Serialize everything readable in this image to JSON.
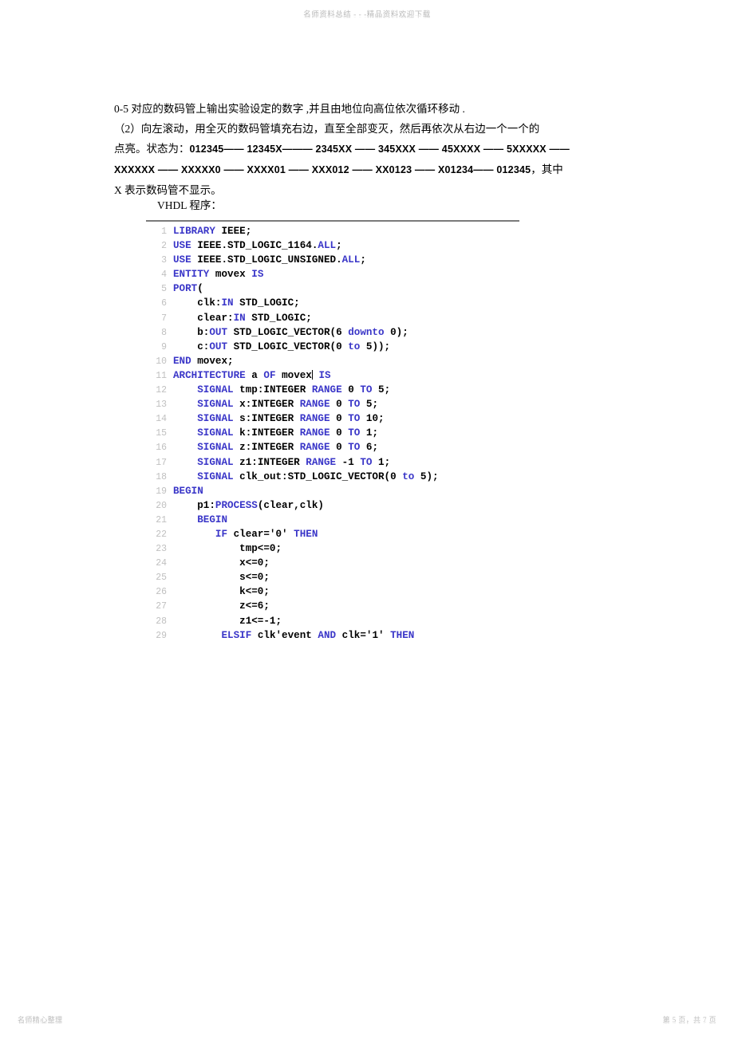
{
  "watermarks": {
    "header": "名师资料总结 - - -精品资料欢迎下载",
    "footer_left": "名师精心整理",
    "footer_right": "第 5 页，共 7 页"
  },
  "prose": {
    "line1_prefix": "0-5",
    "line1": "0-5 对应的数码管上输出实验设定的数字       ,并且由地位向高位依次循环移动        .",
    "line2": "（2）向左滚动，用全灭的数码管填充右边，直至全部变灭，然后再依次从右边一个一个的",
    "line3_prefix": "点亮。状态为：",
    "line3_states": "012345—— 12345X——— 2345XX —— 345XXX —— 45XXXX —— 5XXXXX ——",
    "line4_states": "XXXXXX —— XXXXX0 —— XXXX01 —— XXX012 —— XX0123 —— X01234—— 012345",
    "line4_suffix": "，其中",
    "line5": "X 表示数码管不显示。",
    "vhdl_label": "VHDL  程序："
  },
  "code": {
    "language": "VHDL",
    "keyword_color": "#3a36c8",
    "linenumber_color": "#c0c0c0",
    "lines": [
      {
        "n": "1",
        "tokens": [
          {
            "t": "kw",
            "s": "LIBRARY"
          },
          {
            "t": "id",
            "s": " IEEE;"
          }
        ]
      },
      {
        "n": "2",
        "tokens": [
          {
            "t": "kw",
            "s": "USE"
          },
          {
            "t": "id",
            "s": " IEEE.STD_LOGIC_1164."
          },
          {
            "t": "kw",
            "s": "ALL"
          },
          {
            "t": "id",
            "s": ";"
          }
        ]
      },
      {
        "n": "3",
        "tokens": [
          {
            "t": "kw",
            "s": "USE"
          },
          {
            "t": "id",
            "s": " IEEE.STD_LOGIC_UNSIGNED."
          },
          {
            "t": "kw",
            "s": "ALL"
          },
          {
            "t": "id",
            "s": ";"
          }
        ]
      },
      {
        "n": "4",
        "tokens": [
          {
            "t": "kw",
            "s": "ENTITY"
          },
          {
            "t": "id",
            "s": " movex "
          },
          {
            "t": "kw",
            "s": "IS"
          }
        ]
      },
      {
        "n": "5",
        "tokens": [
          {
            "t": "kw",
            "s": "PORT"
          },
          {
            "t": "id",
            "s": "("
          }
        ]
      },
      {
        "n": "6",
        "tokens": [
          {
            "t": "id",
            "s": "    clk:"
          },
          {
            "t": "kw",
            "s": "IN"
          },
          {
            "t": "id",
            "s": " STD_LOGIC;"
          }
        ]
      },
      {
        "n": "7",
        "tokens": [
          {
            "t": "id",
            "s": "    clear:"
          },
          {
            "t": "kw",
            "s": "IN"
          },
          {
            "t": "id",
            "s": " STD_LOGIC;"
          }
        ]
      },
      {
        "n": "8",
        "tokens": [
          {
            "t": "id",
            "s": "    b:"
          },
          {
            "t": "kw",
            "s": "OUT"
          },
          {
            "t": "id",
            "s": " STD_LOGIC_VECTOR(6 "
          },
          {
            "t": "kw",
            "s": "downto"
          },
          {
            "t": "id",
            "s": " 0);"
          }
        ]
      },
      {
        "n": "9",
        "tokens": [
          {
            "t": "id",
            "s": "    c:"
          },
          {
            "t": "kw",
            "s": "OUT"
          },
          {
            "t": "id",
            "s": " STD_LOGIC_VECTOR(0 "
          },
          {
            "t": "kw",
            "s": "to"
          },
          {
            "t": "id",
            "s": " 5));"
          }
        ]
      },
      {
        "n": "10",
        "tokens": [
          {
            "t": "kw",
            "s": "END"
          },
          {
            "t": "id",
            "s": " movex;"
          }
        ]
      },
      {
        "n": "11",
        "tokens": [
          {
            "t": "kw",
            "s": "ARCHITECTURE"
          },
          {
            "t": "id",
            "s": " a "
          },
          {
            "t": "kw",
            "s": "OF"
          },
          {
            "t": "id",
            "s": " movex"
          },
          {
            "t": "caret",
            "s": ""
          },
          {
            "t": "id",
            "s": " "
          },
          {
            "t": "kw",
            "s": "IS"
          }
        ]
      },
      {
        "n": "12",
        "tokens": [
          {
            "t": "id",
            "s": "    "
          },
          {
            "t": "kw",
            "s": "SIGNAL"
          },
          {
            "t": "id",
            "s": " tmp:INTEGER "
          },
          {
            "t": "kw",
            "s": "RANGE"
          },
          {
            "t": "id",
            "s": " 0 "
          },
          {
            "t": "kw",
            "s": "TO"
          },
          {
            "t": "id",
            "s": " 5;"
          }
        ]
      },
      {
        "n": "13",
        "tokens": [
          {
            "t": "id",
            "s": "    "
          },
          {
            "t": "kw",
            "s": "SIGNAL"
          },
          {
            "t": "id",
            "s": " x:INTEGER "
          },
          {
            "t": "kw",
            "s": "RANGE"
          },
          {
            "t": "id",
            "s": " 0 "
          },
          {
            "t": "kw",
            "s": "TO"
          },
          {
            "t": "id",
            "s": " 5;"
          }
        ]
      },
      {
        "n": "14",
        "tokens": [
          {
            "t": "id",
            "s": "    "
          },
          {
            "t": "kw",
            "s": "SIGNAL"
          },
          {
            "t": "id",
            "s": " s:INTEGER "
          },
          {
            "t": "kw",
            "s": "RANGE"
          },
          {
            "t": "id",
            "s": " 0 "
          },
          {
            "t": "kw",
            "s": "TO"
          },
          {
            "t": "id",
            "s": " 10;"
          }
        ]
      },
      {
        "n": "15",
        "tokens": [
          {
            "t": "id",
            "s": "    "
          },
          {
            "t": "kw",
            "s": "SIGNAL"
          },
          {
            "t": "id",
            "s": " k:INTEGER "
          },
          {
            "t": "kw",
            "s": "RANGE"
          },
          {
            "t": "id",
            "s": " 0 "
          },
          {
            "t": "kw",
            "s": "TO"
          },
          {
            "t": "id",
            "s": " 1;"
          }
        ]
      },
      {
        "n": "16",
        "tokens": [
          {
            "t": "id",
            "s": "    "
          },
          {
            "t": "kw",
            "s": "SIGNAL"
          },
          {
            "t": "id",
            "s": " z:INTEGER "
          },
          {
            "t": "kw",
            "s": "RANGE"
          },
          {
            "t": "id",
            "s": " 0 "
          },
          {
            "t": "kw",
            "s": "TO"
          },
          {
            "t": "id",
            "s": " 6;"
          }
        ]
      },
      {
        "n": "17",
        "tokens": [
          {
            "t": "id",
            "s": "    "
          },
          {
            "t": "kw",
            "s": "SIGNAL"
          },
          {
            "t": "id",
            "s": " z1:INTEGER "
          },
          {
            "t": "kw",
            "s": "RANGE"
          },
          {
            "t": "id",
            "s": " -1 "
          },
          {
            "t": "kw",
            "s": "TO"
          },
          {
            "t": "id",
            "s": " 1;"
          }
        ]
      },
      {
        "n": "18",
        "tokens": [
          {
            "t": "id",
            "s": "    "
          },
          {
            "t": "kw",
            "s": "SIGNAL"
          },
          {
            "t": "id",
            "s": " clk_out:STD_LOGIC_VECTOR(0 "
          },
          {
            "t": "kw",
            "s": "to"
          },
          {
            "t": "id",
            "s": " 5);"
          }
        ]
      },
      {
        "n": "19",
        "tokens": [
          {
            "t": "kw",
            "s": "BEGIN"
          }
        ]
      },
      {
        "n": "20",
        "tokens": [
          {
            "t": "id",
            "s": "    p1:"
          },
          {
            "t": "kw",
            "s": "PROCESS"
          },
          {
            "t": "id",
            "s": "(clear,clk)"
          }
        ]
      },
      {
        "n": "21",
        "tokens": [
          {
            "t": "id",
            "s": "    "
          },
          {
            "t": "kw",
            "s": "BEGIN"
          }
        ]
      },
      {
        "n": "22",
        "tokens": [
          {
            "t": "id",
            "s": "       "
          },
          {
            "t": "kw",
            "s": "IF"
          },
          {
            "t": "id",
            "s": " clear='0' "
          },
          {
            "t": "kw",
            "s": "THEN"
          }
        ]
      },
      {
        "n": "23",
        "tokens": [
          {
            "t": "id",
            "s": "           tmp<=0;"
          }
        ]
      },
      {
        "n": "24",
        "tokens": [
          {
            "t": "id",
            "s": "           x<=0;"
          }
        ]
      },
      {
        "n": "25",
        "tokens": [
          {
            "t": "id",
            "s": "           s<=0;"
          }
        ]
      },
      {
        "n": "26",
        "tokens": [
          {
            "t": "id",
            "s": "           k<=0;"
          }
        ]
      },
      {
        "n": "27",
        "tokens": [
          {
            "t": "id",
            "s": "           z<=6;"
          }
        ]
      },
      {
        "n": "28",
        "tokens": [
          {
            "t": "id",
            "s": "           z1<=-1;"
          }
        ]
      },
      {
        "n": "29",
        "tokens": [
          {
            "t": "id",
            "s": "        "
          },
          {
            "t": "kw",
            "s": "ELSIF"
          },
          {
            "t": "id",
            "s": " clk'event "
          },
          {
            "t": "kw",
            "s": "AND"
          },
          {
            "t": "id",
            "s": " clk='1' "
          },
          {
            "t": "kw",
            "s": "THEN"
          }
        ]
      }
    ]
  }
}
